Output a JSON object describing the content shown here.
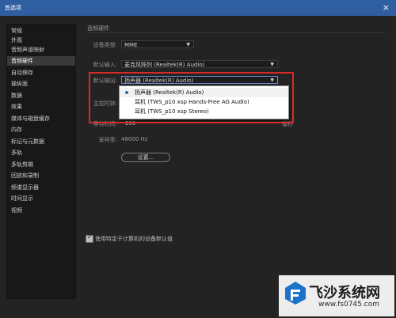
{
  "window": {
    "title": "首选项",
    "close_glyph": "×"
  },
  "sidebar": {
    "items": [
      {
        "label": "常规"
      },
      {
        "label": "外观"
      },
      {
        "label": "音频声道映射"
      },
      {
        "label": "音频硬件",
        "active": true
      },
      {
        "label": "自动保存"
      },
      {
        "label": "操纵面"
      },
      {
        "label": "数据"
      },
      {
        "label": "效果"
      },
      {
        "label": "媒体与磁盘缓存"
      },
      {
        "label": "内存"
      },
      {
        "label": "标记与元数据"
      },
      {
        "label": "多轨"
      },
      {
        "label": "多轨剪辑"
      },
      {
        "label": "回放和录制"
      },
      {
        "label": "频谱显示器"
      },
      {
        "label": "时间显示"
      },
      {
        "label": "视频"
      }
    ]
  },
  "main": {
    "section_title": "音频硬件",
    "device_class": {
      "label": "设备类型:",
      "value": "MME"
    },
    "default_input": {
      "label": "默认输入:",
      "value": "麦克风阵列 (Realtek(R) Audio)"
    },
    "default_output": {
      "label": "默认输出:",
      "value": "扬声器 (Realtek(R) Audio)"
    },
    "master_clock_label": "主控时钟:",
    "latency": {
      "label": "等待时间:",
      "value": "200",
      "suffix": "毫秒"
    },
    "sample_rate": {
      "label": "采样率:",
      "value": "48000 Hz"
    },
    "settings_button": "设置...",
    "checkbox": {
      "label": "使用特定于计算机的设备默认值",
      "checked": true
    }
  },
  "output_popup": {
    "options": [
      {
        "label": "扬声器 (Realtek(R) Audio)",
        "selected": true
      },
      {
        "label": "耳机 (TWS_p10 xsp Hands-Free AG Audio)"
      },
      {
        "label": "耳机 (TWS_p10 xsp Stereo)"
      }
    ]
  },
  "watermark": {
    "text": "飞沙系统网",
    "url": "www.fs0745.com"
  },
  "colors": {
    "titlebar": "#2f5fa1",
    "highlight": "#d62a2a",
    "background": "#232323",
    "accent": "#2f6fb5"
  },
  "icons": {
    "chevron": "chevron-down-icon",
    "close": "close-icon",
    "check": "check-icon",
    "bullet": "radio-dot-icon"
  }
}
